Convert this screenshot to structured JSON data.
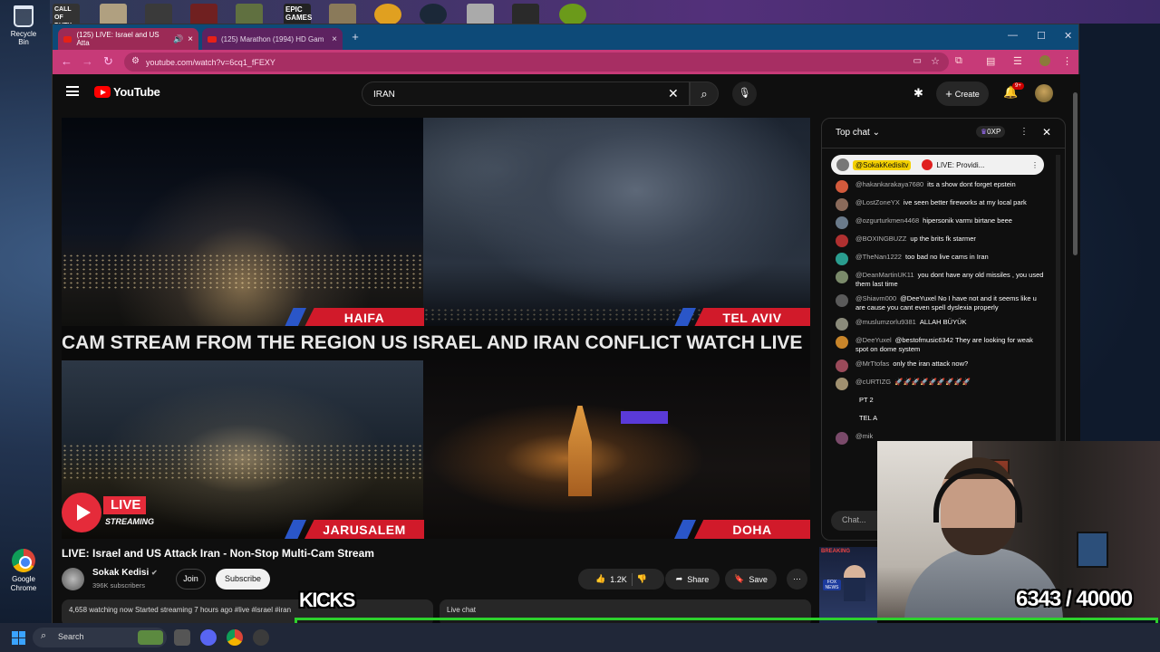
{
  "desktop": {
    "recycle_bin": "Recycle Bin",
    "google_chrome": "Google Chrome",
    "top_icon_texts": {
      "call_of_duty": "CALL OF DUTY",
      "epic_games": "EPIC GAMES"
    }
  },
  "browser": {
    "tabs": [
      {
        "title": "(125) LIVE: Israel and US Atta",
        "active": true
      },
      {
        "title": "(125) Marathon (1994) HD Gam",
        "active": false
      }
    ],
    "url": "youtube.com/watch?v=6cq1_fFEXY"
  },
  "youtube": {
    "logo_text": "YouTube",
    "search_value": "IRAN",
    "create_label": "Create",
    "notifications_badge": "9+",
    "video": {
      "ticker": "CAM STREAM FROM THE REGION US ISRAEL AND IRAN CONFLICT WATCH LIVE",
      "cams": [
        "HAIFA",
        "TEL AVIV",
        "JARUSALEM",
        "DOHA"
      ],
      "live_badge": "LIVE",
      "streaming_label": "STREAMING"
    },
    "title": "LIVE: Israel and US Attack Iran - Non-Stop Multi-Cam Stream",
    "channel": {
      "name": "Sokak Kedisi",
      "subscribers": "396K subscribers"
    },
    "join_label": "Join",
    "subscribe_label": "Subscribe",
    "likes": "1.2K",
    "share_label": "Share",
    "save_label": "Save",
    "meta_line": "4,658 watching now  Started streaming 7 hours ago  #live #israel #iran",
    "live_chat_label": "Live chat",
    "ad": {
      "breaking": "BREAKING",
      "network": "FOX NEWS"
    }
  },
  "chat": {
    "header": "Top chat",
    "points": "0XP",
    "pinned": {
      "author": "@SokakKedisitv",
      "text": "LIVE: Providi..."
    },
    "messages": [
      {
        "author": "@hakankarakaya7680",
        "text": "its a show dont forget epstein",
        "color": "#d35a3c"
      },
      {
        "author": "@LostZoneYX",
        "text": "ive seen better fireworks at my local park",
        "color": "#8a6a5a"
      },
      {
        "author": "@ozgurturkmen4468",
        "text": "hipersonik varmı birtane beee",
        "color": "#6a7a8a"
      },
      {
        "author": "@BOXINGBUZZ",
        "text": "up the brits fk starmer",
        "color": "#b03030"
      },
      {
        "author": "@TheNan1222",
        "text": "too bad no live cams in Iran",
        "color": "#2a9d8f"
      },
      {
        "author": "@DeanMartinUK11",
        "text": "you dont have any old missiles , you used them last time",
        "color": "#7a8a6a"
      },
      {
        "author": "@Shiavm000",
        "text": "@DeeYuxel No I have not and it seems like u are cause you cant even spell dyslexia properly",
        "color": "#5a5a5a"
      },
      {
        "author": "@muslumzorlu9381",
        "text": "ALLAH BÜYÜK",
        "color": "#8a8a7a"
      },
      {
        "author": "@DeeYuxel",
        "text": "@bestofmusic6342 They are looking for weak spot on dome system",
        "color": "#c8852a"
      },
      {
        "author": "@MrTtofas",
        "text": "only the iran attack now?",
        "color": "#9a4a5a"
      },
      {
        "author": "@cURTIZG",
        "text": "🚀🚀🚀🚀🚀🚀🚀🚀🚀",
        "color": "#a09070"
      },
      {
        "author": "",
        "text": "PT 2",
        "color": "transparent"
      },
      {
        "author": "",
        "text": "TEL A",
        "color": "transparent"
      },
      {
        "author": "@mik",
        "text": "",
        "color": "#7a4a6a"
      }
    ],
    "input_placeholder": "Chat..."
  },
  "overlay": {
    "kicks_label": "KICKS",
    "counter": "6343 / 40000",
    "progress_fraction": 0.15
  },
  "taskbar": {
    "search_label": "Search"
  }
}
